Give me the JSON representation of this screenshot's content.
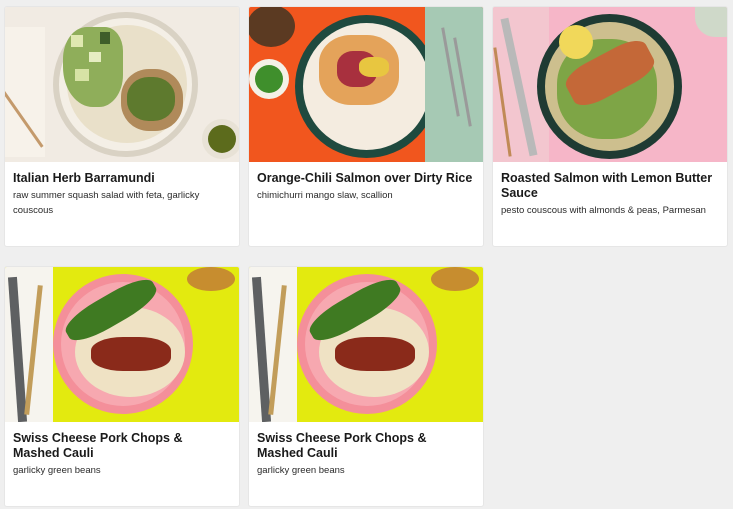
{
  "cards": [
    {
      "title": "Italian Herb Barramundi",
      "description": "raw summer squash salad with feta, garlicky couscous"
    },
    {
      "title": "Orange-Chili Salmon over Dirty Rice",
      "description": "chimichurri mango slaw, scallion"
    },
    {
      "title": "Roasted Salmon with Lemon Butter Sauce",
      "description": "pesto couscous with almonds & peas, Parmesan"
    },
    {
      "title": "Swiss Cheese Pork Chops & Mashed Cauli",
      "description": "garlicky green beans"
    },
    {
      "title": "Swiss Cheese Pork Chops & Mashed Cauli",
      "description": "garlicky green beans"
    }
  ]
}
